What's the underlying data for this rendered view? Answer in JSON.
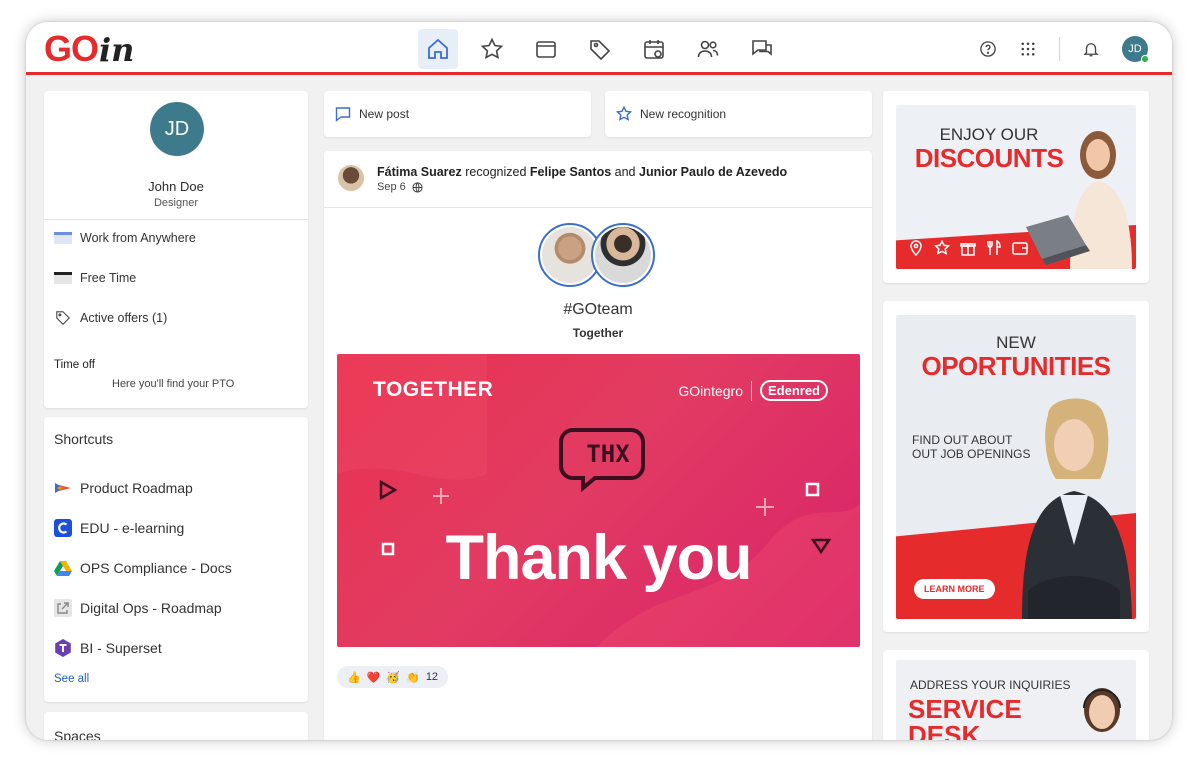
{
  "app": {
    "logo_go": "GO",
    "logo_in": "in",
    "accent": "#e52b2b",
    "brand_blue": "#1f5fc7"
  },
  "topbar": {
    "nav": [
      {
        "icon": "home-icon",
        "active": true
      },
      {
        "icon": "star-icon",
        "active": false
      },
      {
        "icon": "wallet-icon",
        "active": false
      },
      {
        "icon": "tag-icon",
        "active": false
      },
      {
        "icon": "calendar-icon",
        "active": false
      },
      {
        "icon": "people-icon",
        "active": false
      },
      {
        "icon": "chat-icon",
        "active": false
      }
    ],
    "user_initials": "JD"
  },
  "profile": {
    "initials": "JD",
    "name": "John Doe",
    "role": "Designer",
    "items": [
      {
        "label": "Work from Anywhere",
        "icon": "work-anywhere-icon"
      },
      {
        "label": "Free Time",
        "icon": "free-time-icon"
      },
      {
        "label": "Active offers (1)",
        "icon": "tag-icon"
      }
    ],
    "timeoff_title": "Time off",
    "timeoff_sub": "Here you'll find your PTO"
  },
  "shortcuts": {
    "title": "Shortcuts",
    "items": [
      {
        "label": "Product Roadmap",
        "icon": "roadmap-icon"
      },
      {
        "label": "EDU - e-learning",
        "icon": "edu-icon"
      },
      {
        "label": "OPS Compliance - Docs",
        "icon": "drive-icon"
      },
      {
        "label": "Digital Ops - Roadmap",
        "icon": "link-icon"
      },
      {
        "label": "BI - Superset",
        "icon": "superset-icon"
      }
    ],
    "see_all": "See all"
  },
  "spaces": {
    "title": "Spaces"
  },
  "actions": {
    "new_post": "New post",
    "new_recognition": "New recognition"
  },
  "post": {
    "author": "Fátima Suarez",
    "verb": "recognized",
    "recipient1": "Felipe Santos",
    "connector": "and",
    "recipient2": "Junior Paulo de Azevedo",
    "date": "Sep 6",
    "hashtag": "#GOteam",
    "value": "Together",
    "banner": {
      "title": "TOGETHER",
      "brand1": "GOintegro",
      "brand2": "Edenred",
      "bubble": "THX",
      "message": "Thank you"
    },
    "reactions": {
      "emojis": [
        "👍",
        "❤️",
        "🥳",
        "👏"
      ],
      "count": "12"
    }
  },
  "ads": {
    "ad1": {
      "small": "ENJOY OUR",
      "big": "DISCOUNTS"
    },
    "ad2": {
      "small": "NEW",
      "big": "OPORTUNITIES",
      "sub1": "FIND OUT ABOUT",
      "sub2": "OUT JOB OPENINGS",
      "cta": "LEARN MORE"
    },
    "ad3": {
      "small": "ADDRESS YOUR INQUIRIES",
      "big": "SERVICE",
      "big2": "DESK"
    }
  }
}
